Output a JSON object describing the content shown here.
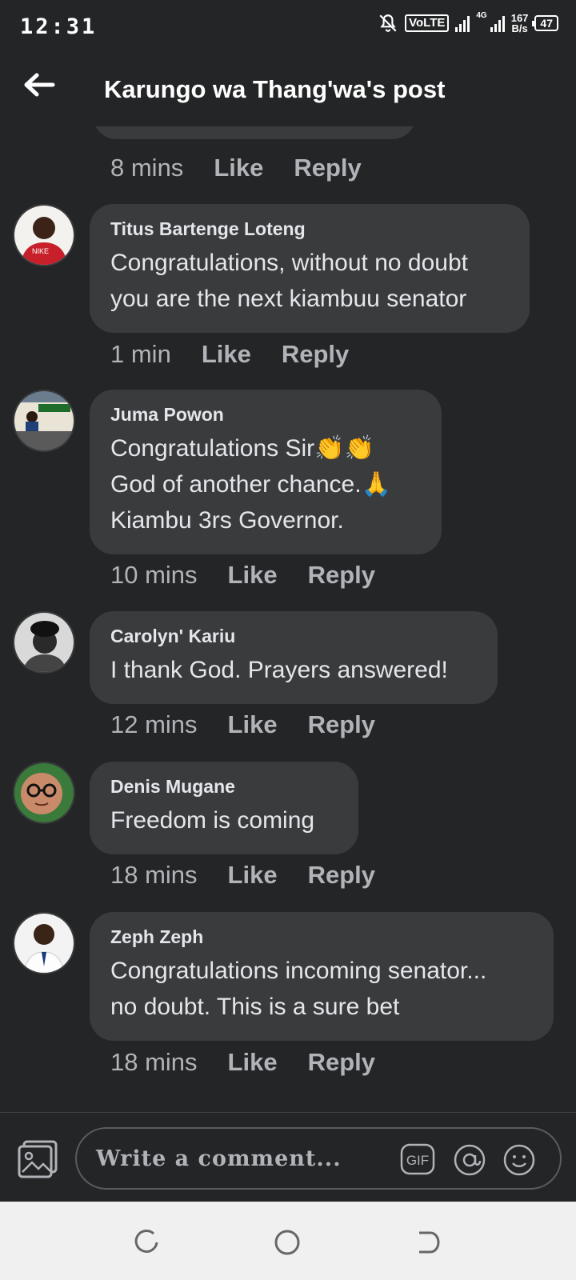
{
  "status_bar": {
    "time": "12:31",
    "network_type": "4G",
    "volte": "VoLTE",
    "speed_value": "167",
    "speed_unit": "B/s",
    "battery": "47"
  },
  "header": {
    "title": "Karungo wa Thang'wa's post"
  },
  "previous_comment": {
    "time": "8 mins",
    "like": "Like",
    "reply": "Reply"
  },
  "comments": [
    {
      "author": "Titus Bartenge Loteng",
      "text": "Congratulations, without no doubt\nyou are the next kiambuu senator",
      "time": "1 min",
      "like": "Like",
      "reply": "Reply"
    },
    {
      "author": "Juma Powon",
      "text": "Congratulations Sir👏👏\nGod of another chance.🙏\nKiambu 3rs Governor.",
      "time": "10 mins",
      "like": "Like",
      "reply": "Reply"
    },
    {
      "author": "Carolyn' Kariu",
      "text": "I thank God. Prayers answered!",
      "time": "12 mins",
      "like": "Like",
      "reply": "Reply"
    },
    {
      "author": "Denis Mugane",
      "text": "Freedom is coming",
      "time": "18 mins",
      "like": "Like",
      "reply": "Reply"
    },
    {
      "author": "Zeph Zeph",
      "text": "Congratulations incoming senator...\nno doubt.  This is a sure bet",
      "time": "18 mins",
      "like": "Like",
      "reply": "Reply"
    }
  ],
  "composer": {
    "placeholder": "Write a comment...",
    "gif_label": "GIF"
  },
  "colors": {
    "background": "#242526",
    "bubble": "#3a3b3c",
    "text_primary": "#e4e6eb",
    "text_secondary": "#b0b3b8"
  }
}
